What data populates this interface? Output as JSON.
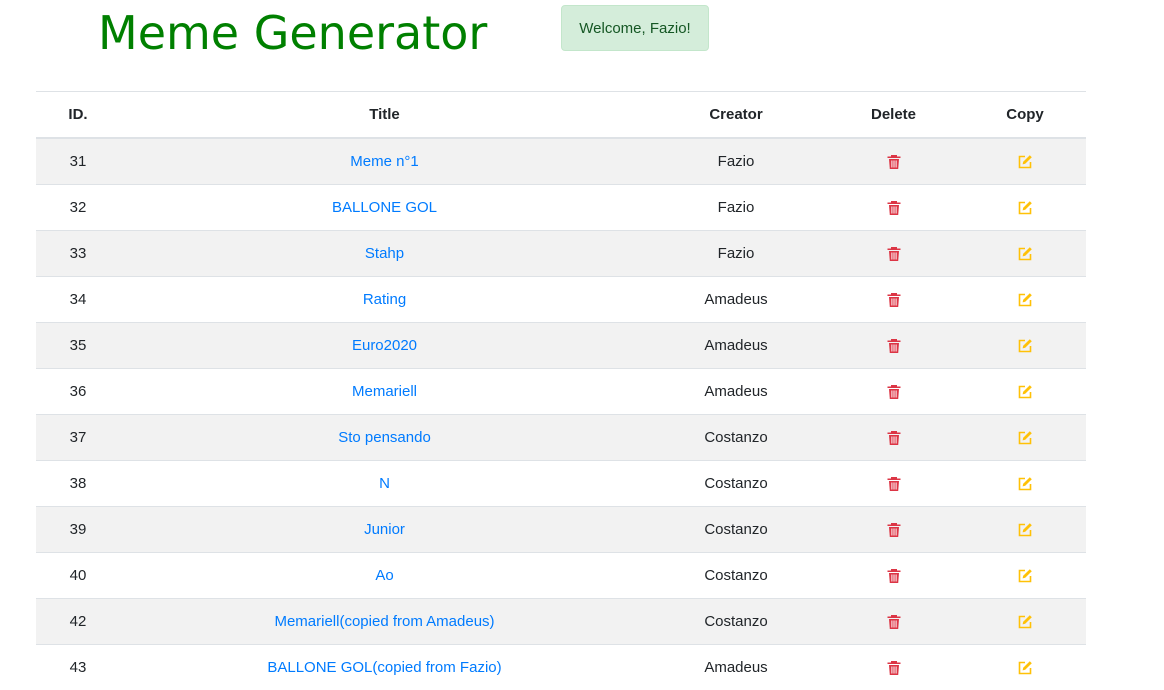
{
  "app": {
    "title": "Meme Generator",
    "welcome": "Welcome, Fazio!"
  },
  "colors": {
    "title": "#008000",
    "link": "#007bff",
    "delete_icon": "#dc3545",
    "copy_icon": "#ffc107"
  },
  "table": {
    "headers": {
      "id": "ID.",
      "title": "Title",
      "creator": "Creator",
      "delete": "Delete",
      "copy": "Copy"
    },
    "delete_icon": "trash-icon",
    "copy_icon": "pencil-square-icon",
    "rows": [
      {
        "id": "31",
        "title": "Meme n°1",
        "creator": "Fazio"
      },
      {
        "id": "32",
        "title": "BALLONE GOL",
        "creator": "Fazio"
      },
      {
        "id": "33",
        "title": "Stahp",
        "creator": "Fazio"
      },
      {
        "id": "34",
        "title": "Rating",
        "creator": "Amadeus"
      },
      {
        "id": "35",
        "title": "Euro2020",
        "creator": "Amadeus"
      },
      {
        "id": "36",
        "title": "Memariell",
        "creator": "Amadeus"
      },
      {
        "id": "37",
        "title": "Sto pensando",
        "creator": "Costanzo"
      },
      {
        "id": "38",
        "title": "N",
        "creator": "Costanzo"
      },
      {
        "id": "39",
        "title": "Junior",
        "creator": "Costanzo"
      },
      {
        "id": "40",
        "title": "Ao",
        "creator": "Costanzo"
      },
      {
        "id": "42",
        "title": "Memariell(copied from Amadeus)",
        "creator": "Costanzo"
      },
      {
        "id": "43",
        "title": "BALLONE GOL(copied from Fazio)",
        "creator": "Amadeus"
      }
    ]
  }
}
